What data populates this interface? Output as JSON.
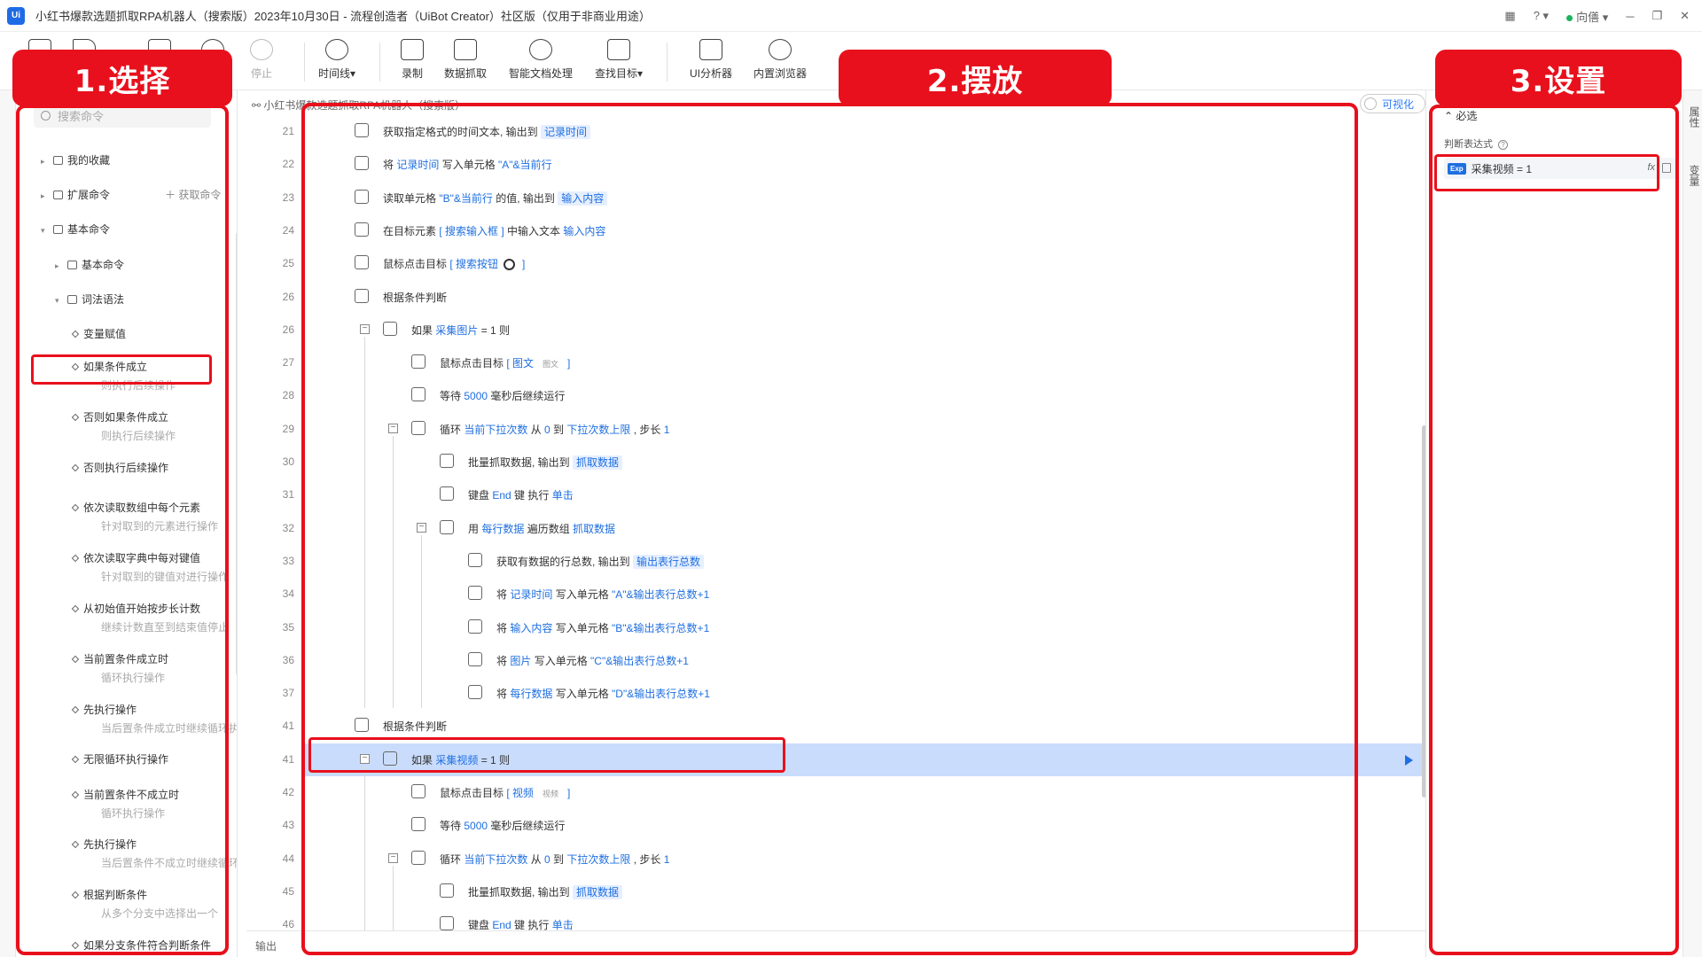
{
  "app": {
    "logo": "Ui",
    "title": "小红书爆款选题抓取RPA机器人（搜索版）2023年10月30日 - 流程创造者（UiBot Creator）社区版（仅用于非商业用途）",
    "user": "向僐"
  },
  "toolbar": {
    "stop_label": "停止",
    "timeline_label": "时间线▾",
    "record_label": "录制",
    "data_capture_label": "数据抓取",
    "doc_label": "智能文档处理",
    "find_target_label": "查找目标▾",
    "ui_analyzer_label": "UI分析器",
    "browser_label": "内置浏览器"
  },
  "annotations": {
    "select": "1.选择",
    "place": "2.摆放",
    "settings": "3.设置"
  },
  "left_panel": {
    "search_placeholder": "搜索命令",
    "tree": {
      "favorites": "我的收藏",
      "extensions": "扩展命令",
      "get_commands": "＋  获取命令",
      "basic_root": "基本命令",
      "basic_child": "基本命令",
      "syntax": "词法语法"
    },
    "commands": [
      {
        "label": "变量赋值",
        "sub": ""
      },
      {
        "label": "如果条件成立",
        "sub": "则执行后续操作"
      },
      {
        "label": "否则如果条件成立",
        "sub": "则执行后续操作"
      },
      {
        "label": "否则执行后续操作",
        "sub": ""
      },
      {
        "label": "依次读取数组中每个元素",
        "sub": "针对取到的元素进行操作"
      },
      {
        "label": "依次读取字典中每对键值",
        "sub": "针对取到的键值对进行操作"
      },
      {
        "label": "从初始值开始按步长计数",
        "sub": "继续计数直至到结束值停止"
      },
      {
        "label": "当前置条件成立时",
        "sub": "循环执行操作"
      },
      {
        "label": "先执行操作",
        "sub": "当后置条件成立时继续循环执行"
      },
      {
        "label": "无限循环执行操作",
        "sub": ""
      },
      {
        "label": "当前置条件不成立时",
        "sub": "循环执行操作"
      },
      {
        "label": "先执行操作",
        "sub": "当后置条件不成立时继续循环执行"
      },
      {
        "label": "根据判断条件",
        "sub": "从多个分支中选择出一个"
      },
      {
        "label": "如果分支条件符合判断条件",
        "sub": ""
      }
    ]
  },
  "editor": {
    "tab_label": "小红书爆款选题抓取RPA机器人（搜索版）",
    "visual_toggle": "可视化",
    "output_label": "输出",
    "lines": [
      {
        "num": "21",
        "text": "获取指定格式的时间文本, 输出到 ",
        "var": "记录时间"
      },
      {
        "num": "22",
        "a": "将 ",
        "b": "记录时间",
        "c": " 写入单元格 ",
        "d": "\"A\"&当前行"
      },
      {
        "num": "23",
        "a": "读取单元格 ",
        "b": "\"B\"&当前行",
        "c": " 的值, 输出到 ",
        "d": "输入内容"
      },
      {
        "num": "24",
        "a": "在目标元素 ",
        "b": "[ 搜索输入框        ]",
        "c": " 中输入文本 ",
        "d": "输入内容"
      },
      {
        "num": "25",
        "a": "鼠标点击目标 ",
        "b": "[ 搜索按钮",
        "c": "]"
      },
      {
        "num": "26",
        "text": "根据条件判断"
      },
      {
        "num": "26",
        "a": "如果 ",
        "b": "采集图片",
        "c": " = 1 则"
      },
      {
        "num": "27",
        "a": "鼠标点击目标 ",
        "b": "[ 图文",
        "c": "图文",
        "d": "]"
      },
      {
        "num": "28",
        "a": "等待 ",
        "b": "5000",
        "c": " 毫秒后继续运行"
      },
      {
        "num": "29",
        "a": "循环 ",
        "b": "当前下拉次数",
        "c": " 从 ",
        "d": "0",
        "e": " 到 ",
        "f": "下拉次数上限",
        "g": " , 步长 ",
        "h": "1"
      },
      {
        "num": "30",
        "text": "批量抓取数据, 输出到 ",
        "var": "抓取数据"
      },
      {
        "num": "31",
        "a": "键盘 ",
        "b": "End",
        "c": " 键 执行 ",
        "d": "单击"
      },
      {
        "num": "32",
        "a": "用 ",
        "b": "每行数据",
        "c": " 遍历数组 ",
        "d": "抓取数据"
      },
      {
        "num": "33",
        "text": "获取有数据的行总数, 输出到 ",
        "var": "输出表行总数"
      },
      {
        "num": "34",
        "a": "将 ",
        "b": "记录时间",
        "c": " 写入单元格 ",
        "d": "\"A\"&输出表行总数+1"
      },
      {
        "num": "35",
        "a": "将 ",
        "b": "输入内容",
        "c": " 写入单元格 ",
        "d": "\"B\"&输出表行总数+1"
      },
      {
        "num": "36",
        "a": "将 ",
        "b": "图片",
        "c": " 写入单元格 ",
        "d": "\"C\"&输出表行总数+1"
      },
      {
        "num": "37",
        "a": "将 ",
        "b": "每行数据",
        "c": " 写入单元格 ",
        "d": "\"D\"&输出表行总数+1"
      },
      {
        "num": "41",
        "text": "根据条件判断"
      },
      {
        "num": "41",
        "a": "如果 ",
        "b": "采集视频",
        "c": " = 1 则"
      },
      {
        "num": "42",
        "a": "鼠标点击目标 ",
        "b": "[ 视频",
        "c": "视频",
        "d": "]"
      },
      {
        "num": "43",
        "a": "等待 ",
        "b": "5000",
        "c": " 毫秒后继续运行"
      },
      {
        "num": "44",
        "a": "循环 ",
        "b": "当前下拉次数",
        "c": " 从 ",
        "d": "0",
        "e": " 到 ",
        "f": "下拉次数上限",
        "g": " , 步长 ",
        "h": "1"
      },
      {
        "num": "45",
        "text": "批量抓取数据, 输出到 ",
        "var": "抓取数据"
      },
      {
        "num": "46",
        "a": "键盘 ",
        "b": "End",
        "c": " 键 执行 ",
        "d": "单击"
      }
    ]
  },
  "right_panel": {
    "required_label": "⌃ 必选",
    "expr_label": "判断表达式",
    "help": "?",
    "exp_badge": "Exp",
    "expr_value": "采集视频 = 1",
    "fx": "fx",
    "rail_top": "属性",
    "rail_bottom": "变量"
  },
  "colors": {
    "annotation_red": "#e8101c",
    "accent_blue": "#1f6fe0",
    "selected_row": "#c9dcfb"
  }
}
